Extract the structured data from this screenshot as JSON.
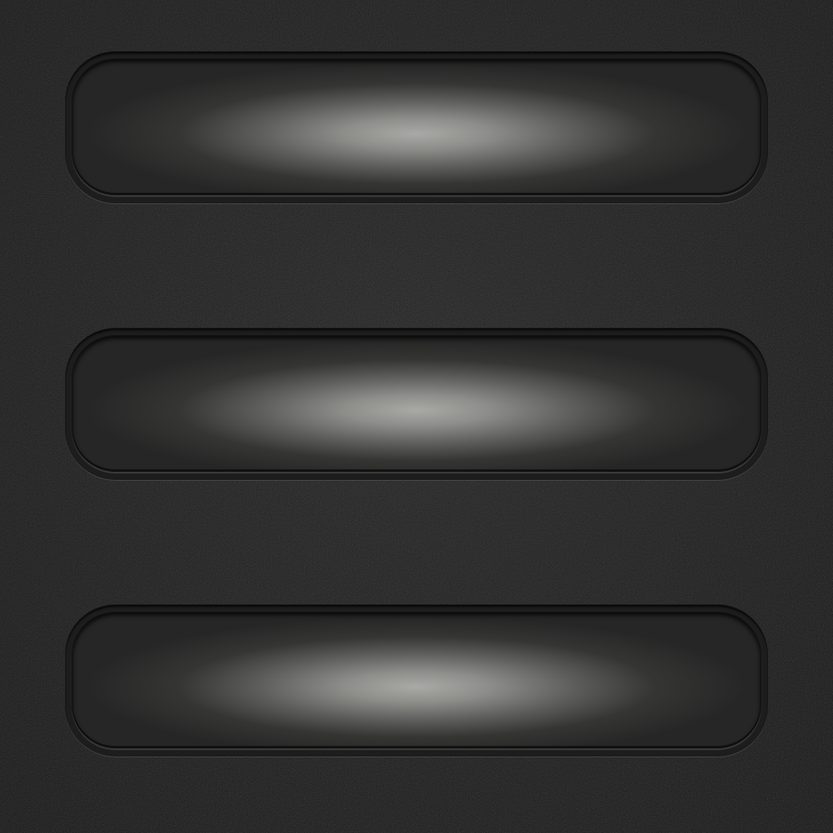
{
  "screen": {
    "background_color": "#1b1b1b",
    "panel_highlight_color": "#a9a9a6",
    "panels": [
      {
        "label": ""
      },
      {
        "label": ""
      },
      {
        "label": ""
      }
    ]
  }
}
